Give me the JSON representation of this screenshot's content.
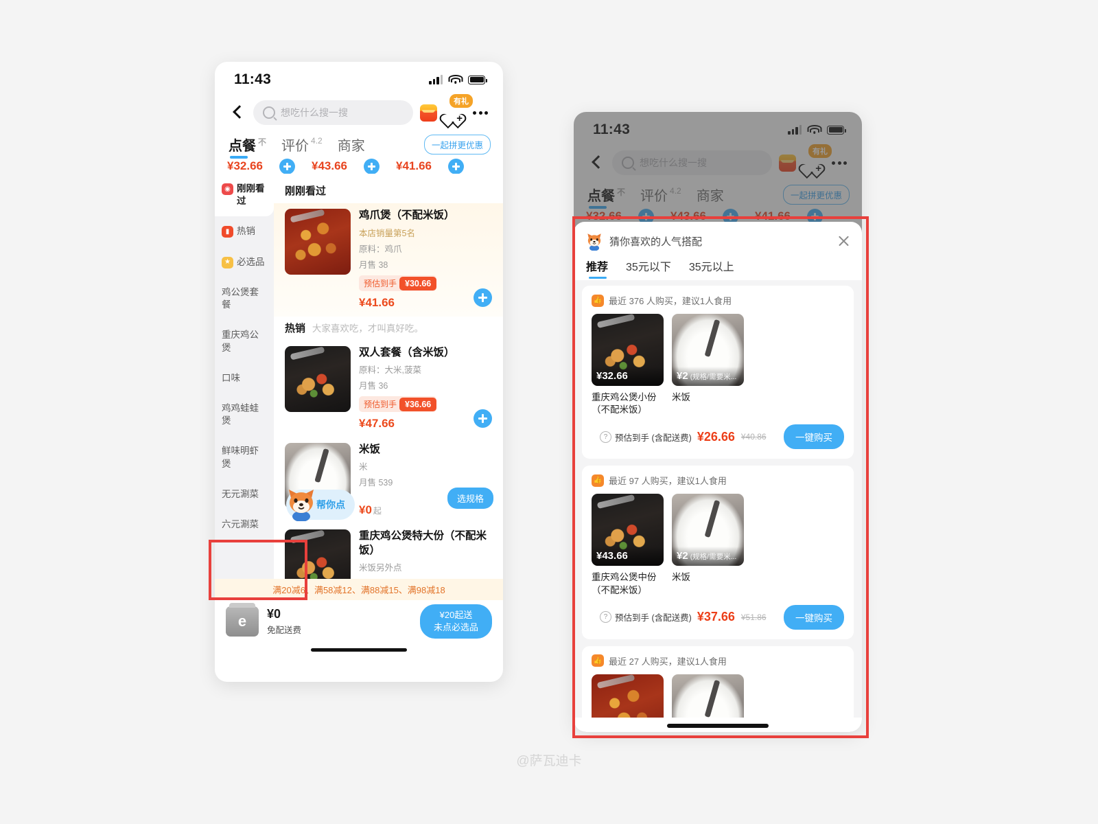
{
  "background_color": "#f4f4f4",
  "accent_blue": "#41aef5",
  "accent_red": "#ec4a1d",
  "annotation_color": "#e8403c",
  "watermark": "@萨瓦迪卡",
  "status_bar": {
    "time": "11:43"
  },
  "header": {
    "back_icon": "chevron-left-icon",
    "search_placeholder": "想吃什么搜一搜",
    "coupon_icon": "red-packet-icon",
    "favorite_icon": "heart-plus-icon",
    "favorite_badge": "有礼",
    "more_icon": "more-dots-icon"
  },
  "tabs": {
    "items": [
      {
        "label": "点餐",
        "sup": "不",
        "active": true
      },
      {
        "label": "评价",
        "sup": "4.2",
        "active": false
      },
      {
        "label": "商家",
        "sup": "",
        "active": false
      }
    ],
    "group_buy_button": "一起拼更优惠"
  },
  "clipped_price_strip": {
    "prices": [
      "¥32.66",
      "¥43.66",
      "¥41.66"
    ]
  },
  "sidebar": {
    "items": [
      {
        "label": "刚刚看过",
        "icon": "eye-icon",
        "active": true
      },
      {
        "label": "热销",
        "icon": "flame-icon",
        "active": false
      },
      {
        "label": "必选品",
        "icon": "star-icon",
        "active": false
      },
      {
        "label": "鸡公煲套餐",
        "icon": "",
        "active": false
      },
      {
        "label": "重庆鸡公煲",
        "icon": "",
        "active": false
      },
      {
        "label": "口味",
        "icon": "",
        "active": false
      },
      {
        "label": "鸡鸡蛙蛙煲",
        "icon": "",
        "active": false
      },
      {
        "label": "鲜味明虾煲",
        "icon": "",
        "active": false
      },
      {
        "label": "无元涮菜",
        "icon": "",
        "active": false
      },
      {
        "label": "六元涮菜",
        "icon": "",
        "active": false
      }
    ]
  },
  "list": {
    "recent_heading": "刚刚看过",
    "section_heading": {
      "title": "热销",
      "subtitle": "大家喜欢吃，才叫真好吃。"
    },
    "dishes": [
      {
        "name": "鸡爪煲（不配米饭）",
        "rank": "本店销量第5名",
        "ingredients": "原料：鸡爪",
        "monthly_sales": "月售 38",
        "estimate_label": "预估到手",
        "estimate_price": "¥30.66",
        "price": "¥41.66",
        "action": "add",
        "highlight": true,
        "photo": "chicken-feet-pot"
      },
      {
        "name": "双人套餐（含米饭）",
        "rank": "",
        "ingredients": "原料：大米,菠菜",
        "monthly_sales": "月售 36",
        "estimate_label": "预估到手",
        "estimate_price": "¥36.66",
        "price": "¥47.66",
        "action": "add",
        "highlight": false,
        "photo": "chicken-pot-dark"
      },
      {
        "name": "米饭",
        "rank": "",
        "ingredients": "米",
        "monthly_sales": "月售 539",
        "estimate_label": "",
        "estimate_price": "",
        "price": "¥0",
        "price_suffix": "起",
        "action_label": "选规格",
        "action": "spec",
        "highlight": false,
        "photo": "white-rice"
      },
      {
        "name": "重庆鸡公煲特大份（不配米饭）",
        "rank": "",
        "ingredients": "米饭另外点",
        "monthly_sales": "",
        "estimate_label": "",
        "estimate_price": "",
        "price": "",
        "action": "none",
        "highlight": false,
        "photo": "chicken-pot-dark"
      }
    ],
    "assistant_chip": {
      "label": "帮你点",
      "icon": "shiba-dog-icon"
    }
  },
  "bottom_bar": {
    "promo": "满20减6、满58减12、满88减15、满98减18",
    "cart_icon": "cart-icon",
    "fee_amount": "¥0",
    "fee_label": "免配送费",
    "go_button_line1": "¥20起送",
    "go_button_line2": "未点必选品"
  },
  "modal": {
    "icon": "shiba-dog-icon",
    "title": "猜你喜欢的人气搭配",
    "close_icon": "close-icon",
    "tabs": [
      {
        "label": "推荐",
        "active": true
      },
      {
        "label": "35元以下",
        "active": false
      },
      {
        "label": "35元以上",
        "active": false
      }
    ],
    "combos": [
      {
        "meta": "最近 376 人购买，建议1人食用",
        "meta_icon": "thumbs-up-icon",
        "items": [
          {
            "name": "重庆鸡公煲小份（不配米饭）",
            "tag_price": "¥32.66",
            "tag_note": "",
            "photo": "chicken-pot-dark"
          },
          {
            "name": "米饭",
            "tag_price": "¥2",
            "tag_note": "(规格/需要米...",
            "photo": "white-rice"
          }
        ],
        "footer_label": "预估到手 (含配送费)",
        "footer_price": "¥26.66",
        "footer_original": "¥40.86",
        "buy_button": "一键购买",
        "help_icon": "question-icon"
      },
      {
        "meta": "最近 97 人购买，建议1人食用",
        "meta_icon": "thumbs-up-icon",
        "items": [
          {
            "name": "重庆鸡公煲中份（不配米饭）",
            "tag_price": "¥43.66",
            "tag_note": "",
            "photo": "chicken-pot-dark"
          },
          {
            "name": "米饭",
            "tag_price": "¥2",
            "tag_note": "(规格/需要米...",
            "photo": "white-rice"
          }
        ],
        "footer_label": "预估到手 (含配送费)",
        "footer_price": "¥37.66",
        "footer_original": "¥51.86",
        "buy_button": "一键购买",
        "help_icon": "question-icon"
      },
      {
        "meta": "最近 27 人购买，建议1人食用",
        "meta_icon": "thumbs-up-icon",
        "items": [
          {
            "name": "",
            "tag_price": "",
            "tag_note": "",
            "photo": "chicken-feet-pot"
          },
          {
            "name": "",
            "tag_price": "",
            "tag_note": "",
            "photo": "white-rice"
          }
        ],
        "footer_label": "",
        "footer_price": "",
        "footer_original": "",
        "buy_button": "",
        "help_icon": ""
      }
    ]
  }
}
